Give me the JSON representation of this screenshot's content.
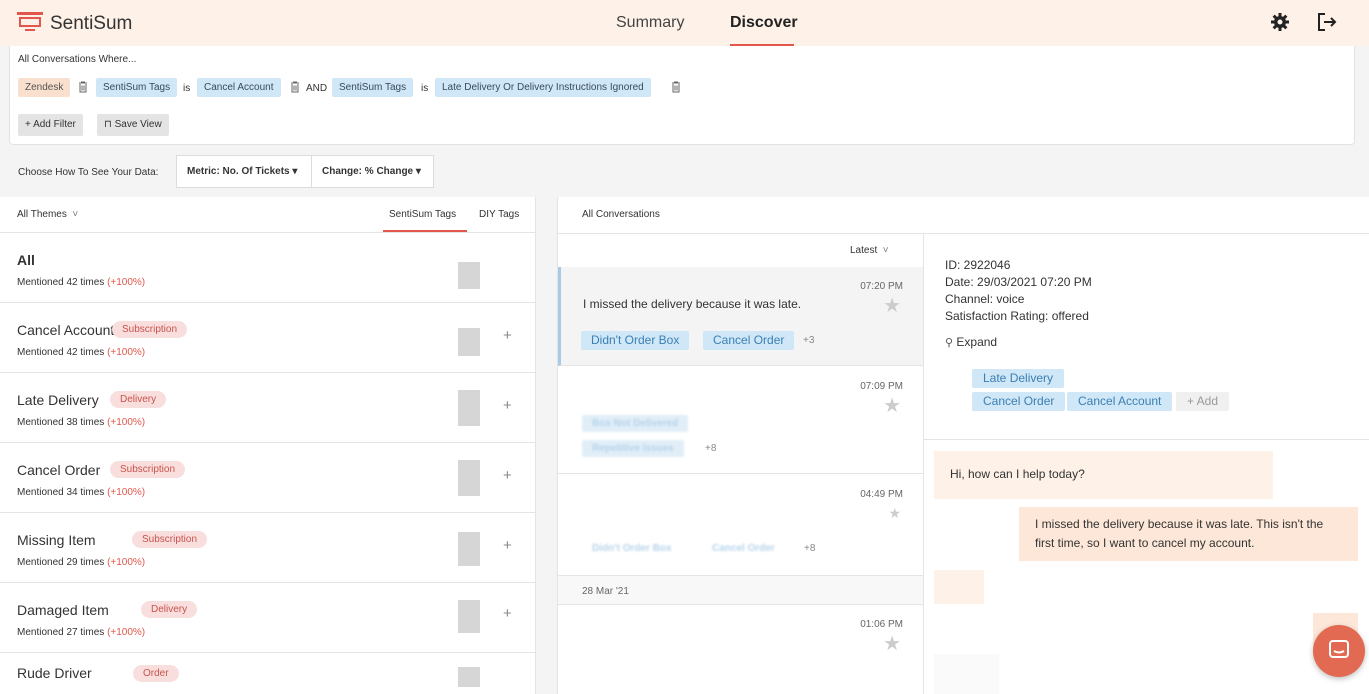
{
  "app": {
    "name": "SentiSum",
    "accent": "#e2574c"
  },
  "nav": {
    "tabs": [
      {
        "label": "Summary"
      },
      {
        "label": "Discover"
      }
    ],
    "active": "Discover"
  },
  "filters": {
    "title": "All Conversations Where...",
    "source": "Zendesk",
    "cond1_field": "SentiSum Tags",
    "is1": "is",
    "cond1_value": "Cancel Account",
    "and": "AND",
    "cond2_field": "SentiSum Tags",
    "is2": "is",
    "cond2_value": "Late Delivery Or Delivery Instructions Ignored",
    "add_filter": "Add Filter",
    "save_view": "Save View"
  },
  "data_view": {
    "label": "Choose How To See Your Data:",
    "metric": "Metric: No. Of Tickets",
    "change": "Change: % Change"
  },
  "themes": {
    "filter_label": "All Themes",
    "tabs": [
      "SentiSum Tags",
      "DIY Tags"
    ],
    "active_tab": "SentiSum Tags",
    "rows": [
      {
        "name": "All",
        "badge": "",
        "meta": "Mentioned 42 times",
        "pct": "(+100%)"
      },
      {
        "name": "Cancel Account",
        "badge": "Subscription",
        "meta": "Mentioned 42 times",
        "pct": "(+100%)"
      },
      {
        "name": "Late Delivery",
        "badge": "Delivery",
        "meta": "Mentioned 38 times",
        "pct": "(+100%)"
      },
      {
        "name": "Cancel Order",
        "badge": "Subscription",
        "meta": "Mentioned 34 times",
        "pct": "(+100%)"
      },
      {
        "name": "Missing Item",
        "badge": "Subscription",
        "meta": "Mentioned 29 times",
        "pct": "(+100%)"
      },
      {
        "name": "Damaged Item",
        "badge": "Delivery",
        "meta": "Mentioned 27 times",
        "pct": "(+100%)"
      },
      {
        "name": "Rude Driver",
        "badge": "Order",
        "meta": "",
        "pct": ""
      }
    ]
  },
  "conversations": {
    "title": "All Conversations",
    "sort": "Latest",
    "items": [
      {
        "time": "07:20 PM",
        "text": "I missed the delivery because it was late.",
        "tags": [
          "Didn't Order Box",
          "Cancel Order"
        ],
        "more": "+3"
      },
      {
        "time": "07:09 PM",
        "tags": [
          "Box Not Delivered",
          "Repetitive Issues"
        ],
        "more": "+8"
      },
      {
        "time": "04:49 PM",
        "tags": [
          "Didn't Order Box",
          "Cancel Order"
        ],
        "more": "+8"
      },
      {
        "time": "01:06 PM"
      }
    ],
    "date_sep": "28 Mar '21"
  },
  "detail": {
    "id": "ID: 2922046",
    "date": "Date: 29/03/2021 07:20 PM",
    "channel": "Channel: voice",
    "rating": "Satisfaction Rating: offered",
    "expand": "Expand",
    "tags": [
      "Late Delivery",
      "Cancel Order",
      "Cancel Account"
    ],
    "add": "+ Add",
    "messages": [
      {
        "from": "agent",
        "text": "Hi, how can I help today?"
      },
      {
        "from": "customer",
        "text": "I missed the delivery because it was late. This isn't the first time, so I want to cancel my account."
      }
    ]
  }
}
